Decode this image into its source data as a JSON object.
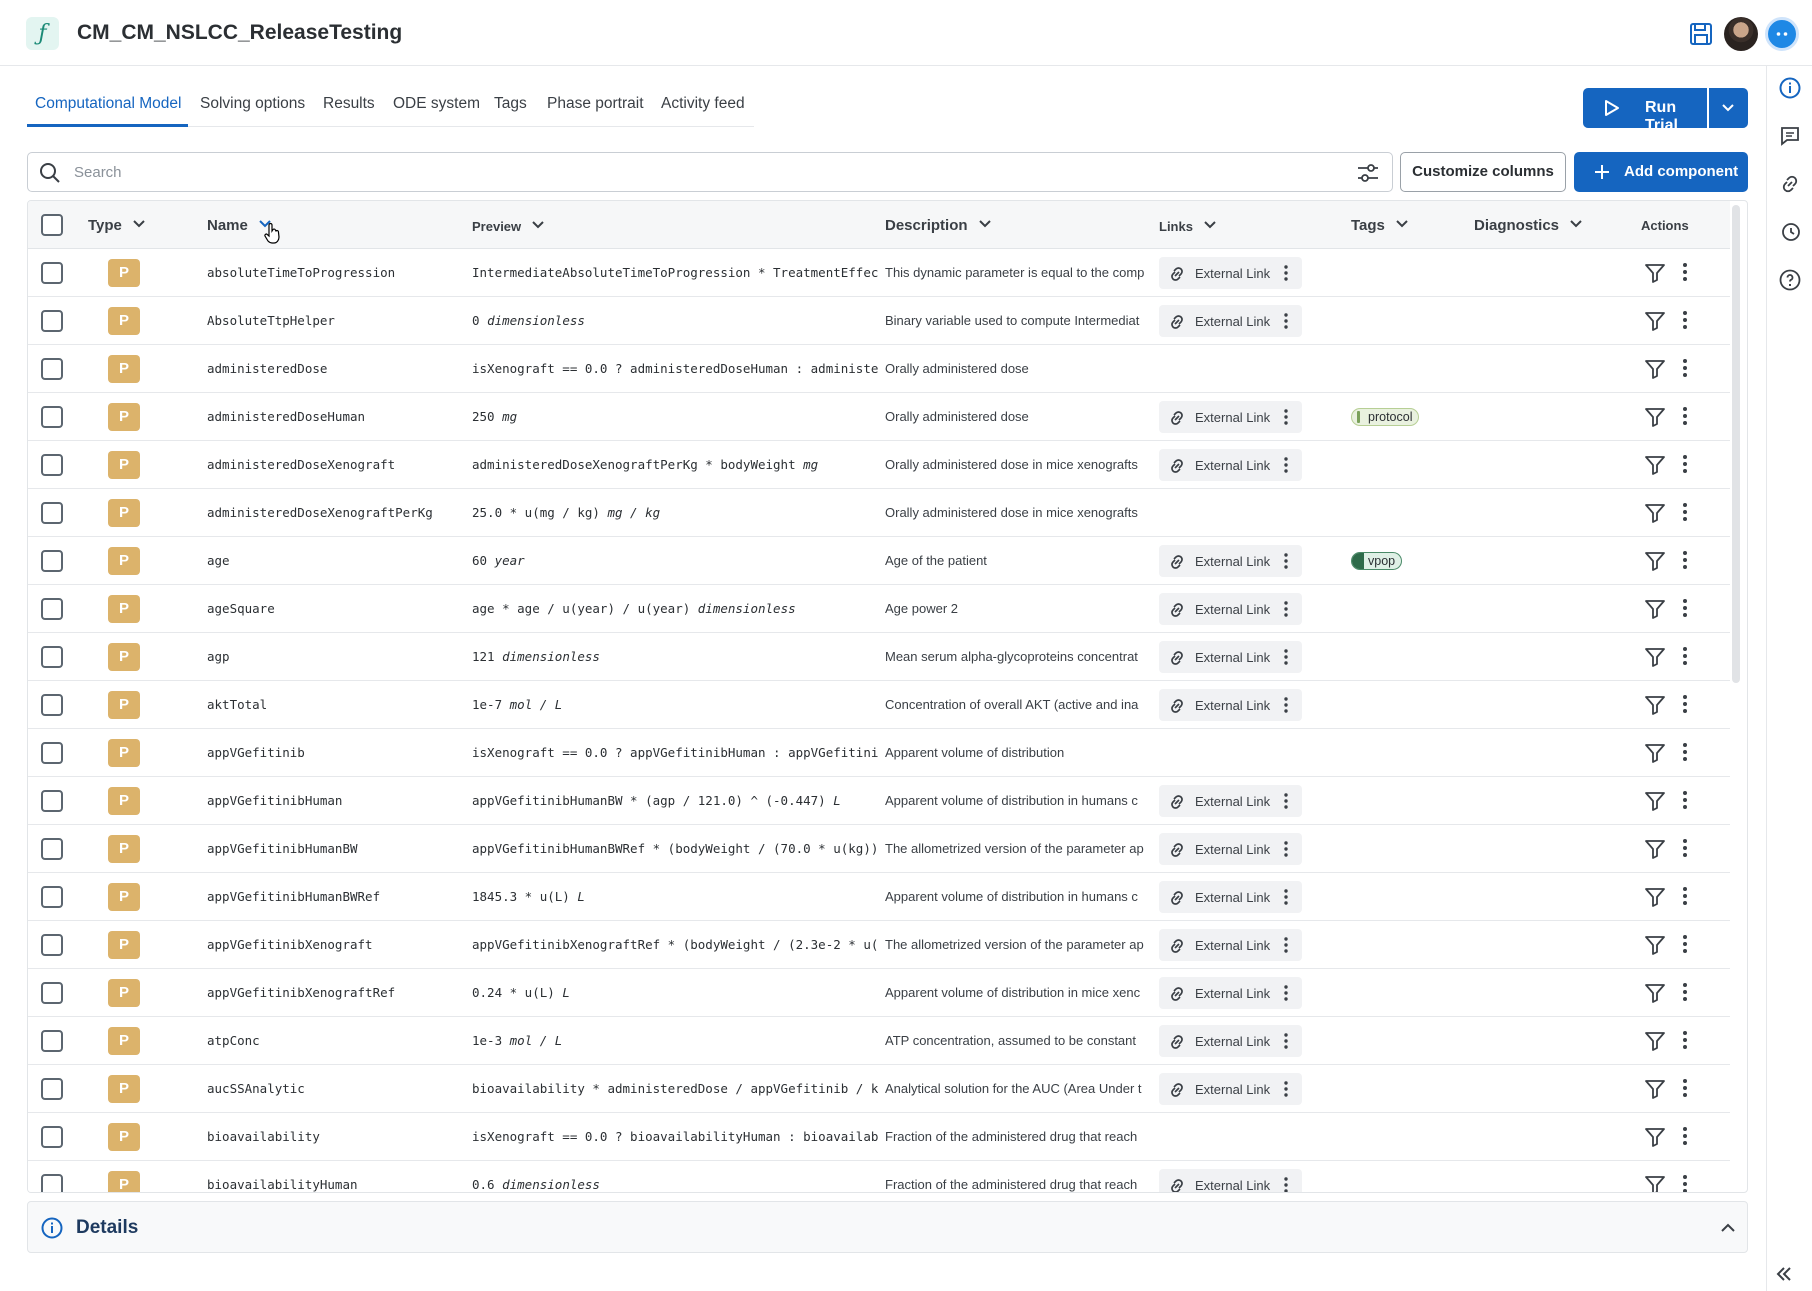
{
  "app": {
    "title": "CM_CM_NSLCC_ReleaseTesting",
    "accent": "#1565c0"
  },
  "tabs": [
    {
      "label": "Computational Model",
      "active": true
    },
    {
      "label": "Solving options"
    },
    {
      "label": "Results"
    },
    {
      "label": "ODE system"
    },
    {
      "label": "Tags"
    },
    {
      "label": "Phase portrait"
    },
    {
      "label": "Activity feed"
    }
  ],
  "toolbar": {
    "run_label": "Run Trial",
    "search_placeholder": "Search",
    "customize_label": "Customize columns",
    "add_label": "Add component"
  },
  "columns": {
    "type": "Type",
    "name": "Name",
    "preview": "Preview",
    "description": "Description",
    "links": "Links",
    "tags": "Tags",
    "diagnostics": "Diagnostics",
    "actions": "Actions"
  },
  "link_label": "External Link",
  "rows": [
    {
      "type": "P",
      "name": "absoluteTimeToProgression",
      "expr": "IntermediateAbsoluteTimeToProgression * TreatmentEffec",
      "unit": "",
      "desc": "This dynamic parameter is equal to the comp",
      "link": true,
      "tag": ""
    },
    {
      "type": "P",
      "name": "AbsoluteTtpHelper",
      "expr": "0",
      "unit": "dimensionless",
      "desc": "Binary variable used to compute Intermediat",
      "link": true,
      "tag": ""
    },
    {
      "type": "P",
      "name": "administeredDose",
      "expr": "isXenograft == 0.0 ? administeredDoseHuman : administe",
      "unit": "",
      "desc": "Orally administered dose",
      "link": false,
      "tag": ""
    },
    {
      "type": "P",
      "name": "administeredDoseHuman",
      "expr": "250",
      "unit": "mg",
      "desc": "Orally administered dose",
      "link": true,
      "tag": "protocol"
    },
    {
      "type": "P",
      "name": "administeredDoseXenograft",
      "expr": "administeredDoseXenograftPerKg * bodyWeight",
      "unit": "mg",
      "desc": "Orally administered dose in mice xenografts",
      "link": true,
      "tag": ""
    },
    {
      "type": "P",
      "name": "administeredDoseXenograftPerKg",
      "expr": "25.0 * u(mg / kg)",
      "unit": "mg / kg",
      "desc": "Orally administered dose in mice xenografts",
      "link": false,
      "tag": ""
    },
    {
      "type": "P",
      "name": "age",
      "expr": "60",
      "unit": "year",
      "desc": "Age of the patient",
      "link": true,
      "tag": "vpop"
    },
    {
      "type": "P",
      "name": "ageSquare",
      "expr": "age * age / u(year) / u(year)",
      "unit": "dimensionless",
      "desc": "Age power 2",
      "link": true,
      "tag": ""
    },
    {
      "type": "P",
      "name": "agp",
      "expr": "121",
      "unit": "dimensionless",
      "desc": "Mean serum alpha-glycoproteins concentrat",
      "link": true,
      "tag": ""
    },
    {
      "type": "P",
      "name": "aktTotal",
      "expr": "1e-7",
      "unit": "mol / L",
      "desc": "Concentration of overall AKT (active and ina",
      "link": true,
      "tag": ""
    },
    {
      "type": "P",
      "name": "appVGefitinib",
      "expr": "isXenograft == 0.0 ? appVGefitinibHuman : appVGefitini",
      "unit": "",
      "desc": "Apparent volume of distribution",
      "link": false,
      "tag": ""
    },
    {
      "type": "P",
      "name": "appVGefitinibHuman",
      "expr": "appVGefitinibHumanBW * (agp / 121.0) ^ (-0.447)",
      "unit": "L",
      "desc": "Apparent volume of distribution in humans c",
      "link": true,
      "tag": ""
    },
    {
      "type": "P",
      "name": "appVGefitinibHumanBW",
      "expr": "appVGefitinibHumanBWRef * (bodyWeight / (70.0 * u(kg))",
      "unit": "",
      "desc": "The allometrized version of the parameter ap",
      "link": true,
      "tag": ""
    },
    {
      "type": "P",
      "name": "appVGefitinibHumanBWRef",
      "expr": "1845.3 * u(L)",
      "unit": "L",
      "desc": "Apparent volume of distribution in humans c",
      "link": true,
      "tag": ""
    },
    {
      "type": "P",
      "name": "appVGefitinibXenograft",
      "expr": "appVGefitinibXenograftRef * (bodyWeight / (2.3e-2 * u(",
      "unit": "",
      "desc": "The allometrized version of the parameter ap",
      "link": true,
      "tag": ""
    },
    {
      "type": "P",
      "name": "appVGefitinibXenograftRef",
      "expr": "0.24 * u(L)",
      "unit": "L",
      "desc": "Apparent volume of distribution in mice xenc",
      "link": true,
      "tag": ""
    },
    {
      "type": "P",
      "name": "atpConc",
      "expr": "1e-3",
      "unit": "mol / L",
      "desc": "ATP concentration, assumed to be constant",
      "link": true,
      "tag": ""
    },
    {
      "type": "P",
      "name": "aucSSAnalytic",
      "expr": "bioavailability * administeredDose / appVGefitinib / k",
      "unit": "",
      "desc": "Analytical solution for the AUC (Area Under t",
      "link": true,
      "tag": ""
    },
    {
      "type": "P",
      "name": "bioavailability",
      "expr": "isXenograft == 0.0 ? bioavailabilityHuman : bioavailab",
      "unit": "",
      "desc": "Fraction of the administered drug that reach",
      "link": false,
      "tag": ""
    },
    {
      "type": "P",
      "name": "bioavailabilityHuman",
      "expr": "0.6",
      "unit": "dimensionless",
      "desc": "Fraction of the administered drug that reach",
      "link": true,
      "tag": ""
    }
  ],
  "details": {
    "title": "Details"
  }
}
